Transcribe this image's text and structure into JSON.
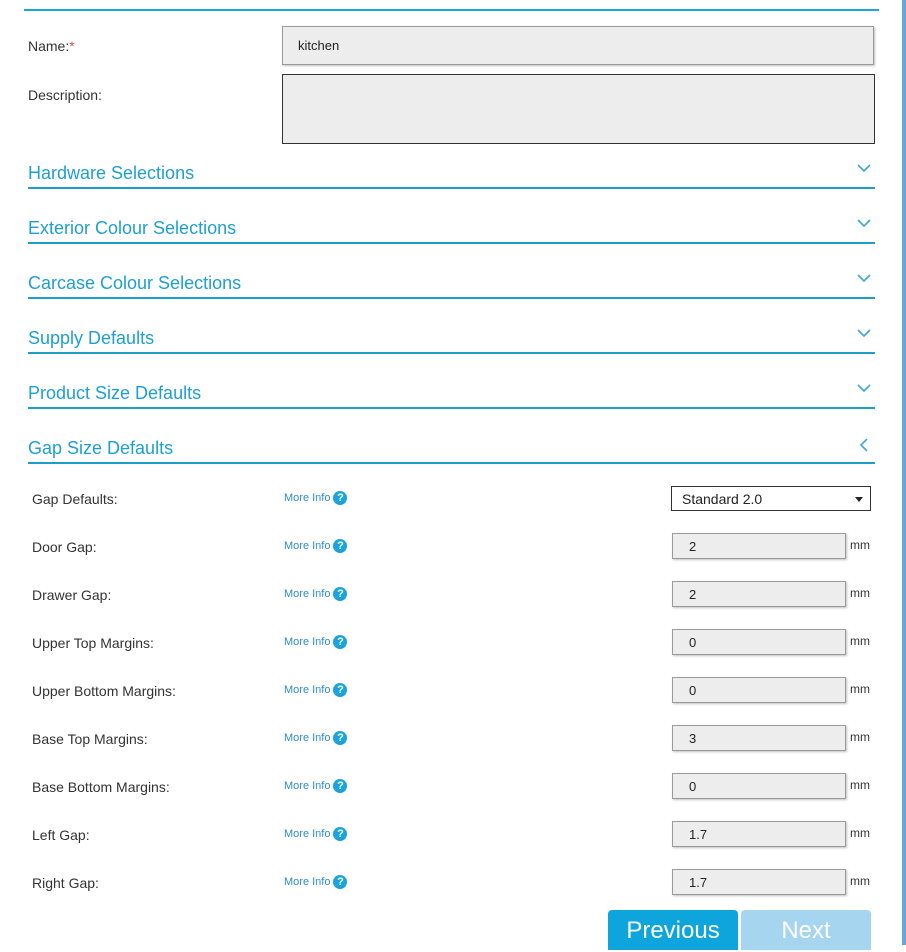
{
  "form": {
    "name_label": "Name:",
    "required_marker": "*",
    "name_value": "kitchen",
    "description_label": "Description:",
    "description_value": ""
  },
  "sections": [
    {
      "title": "Hardware Selections",
      "expanded": false,
      "icon": "chevron-down-icon"
    },
    {
      "title": "Exterior Colour Selections",
      "expanded": false,
      "icon": "chevron-down-icon"
    },
    {
      "title": "Carcase Colour Selections",
      "expanded": false,
      "icon": "chevron-down-icon"
    },
    {
      "title": "Supply Defaults",
      "expanded": false,
      "icon": "chevron-down-icon"
    },
    {
      "title": "Product Size Defaults",
      "expanded": false,
      "icon": "chevron-down-icon"
    },
    {
      "title": "Gap Size Defaults",
      "expanded": true,
      "icon": "chevron-left-icon"
    }
  ],
  "gap_section": {
    "more_info_label": "More Info",
    "help_icon_glyph": "?",
    "unit": "mm",
    "gap_defaults": {
      "label": "Gap Defaults:",
      "selected": "Standard 2.0"
    },
    "rows": [
      {
        "label": "Door Gap:",
        "value": "2"
      },
      {
        "label": "Drawer Gap:",
        "value": "2"
      },
      {
        "label": "Upper Top Margins:",
        "value": "0"
      },
      {
        "label": "Upper Bottom Margins:",
        "value": "0"
      },
      {
        "label": "Base Top Margins:",
        "value": "3"
      },
      {
        "label": "Base Bottom Margins:",
        "value": "0"
      },
      {
        "label": "Left Gap:",
        "value": "1.7"
      },
      {
        "label": "Right Gap:",
        "value": "1.7"
      }
    ]
  },
  "buttons": {
    "previous": "Previous",
    "next": "Next"
  },
  "colors": {
    "accent": "#1e9fd3",
    "previous_button": "#0ea5dc",
    "next_button_disabled": "#a6d5f0",
    "required": "#d9534f"
  }
}
